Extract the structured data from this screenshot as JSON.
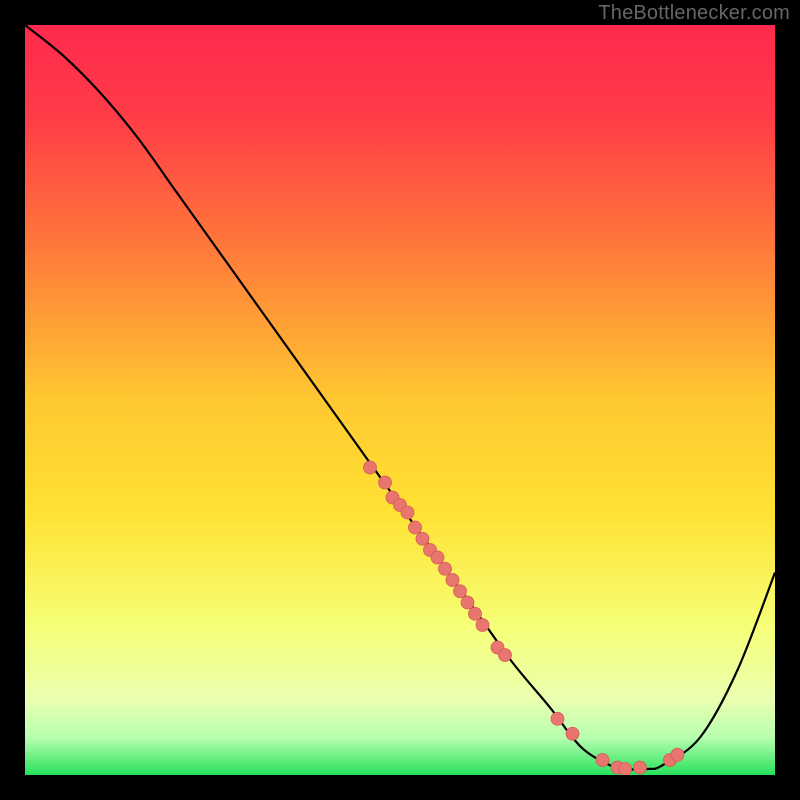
{
  "attribution": "TheBottlenecker.com",
  "colors": {
    "bg_black": "#000000",
    "gradient_top": "#ff2a4d",
    "gradient_mid": "#ffe233",
    "gradient_low": "#f8ffbb",
    "gradient_bottom": "#27e05a",
    "curve": "#000000",
    "marker_fill": "#e8766f",
    "marker_stroke": "#d55a55",
    "attribution_text": "#666666"
  },
  "chart_data": {
    "type": "line",
    "title": "",
    "xlabel": "",
    "ylabel": "",
    "xlim": [
      0,
      100
    ],
    "ylim": [
      0,
      100
    ],
    "x": [
      0,
      5,
      10,
      15,
      20,
      25,
      30,
      35,
      40,
      45,
      50,
      55,
      60,
      65,
      70,
      73,
      75,
      78,
      80,
      83,
      85,
      90,
      95,
      100
    ],
    "y": [
      100,
      96,
      91,
      85,
      78,
      71,
      64,
      57,
      50,
      43,
      36,
      29,
      22,
      15,
      9,
      5,
      3,
      1.3,
      0.8,
      0.8,
      1.3,
      5,
      14,
      27
    ],
    "markers_x": [
      46,
      48,
      49,
      50,
      51,
      52,
      53,
      54,
      55,
      56,
      57,
      58,
      59,
      60,
      61,
      63,
      64,
      71,
      73,
      77,
      79,
      80,
      82,
      86,
      87
    ],
    "markers_y": [
      41,
      39,
      37,
      36,
      35,
      33,
      31.5,
      30,
      29,
      27.5,
      26,
      24.5,
      23,
      21.5,
      20,
      17,
      16,
      7.5,
      5.5,
      2.0,
      1.0,
      0.8,
      1.0,
      2.0,
      2.7
    ],
    "gradient_stops": [
      {
        "offset": 0.0,
        "color": "#ff2a4d"
      },
      {
        "offset": 0.12,
        "color": "#ff3b47"
      },
      {
        "offset": 0.3,
        "color": "#ff7a3a"
      },
      {
        "offset": 0.5,
        "color": "#ffc831"
      },
      {
        "offset": 0.65,
        "color": "#ffe233"
      },
      {
        "offset": 0.8,
        "color": "#f6ff76"
      },
      {
        "offset": 0.9,
        "color": "#eaffb0"
      },
      {
        "offset": 0.95,
        "color": "#b8ffb0"
      },
      {
        "offset": 1.0,
        "color": "#27e05a"
      }
    ]
  }
}
